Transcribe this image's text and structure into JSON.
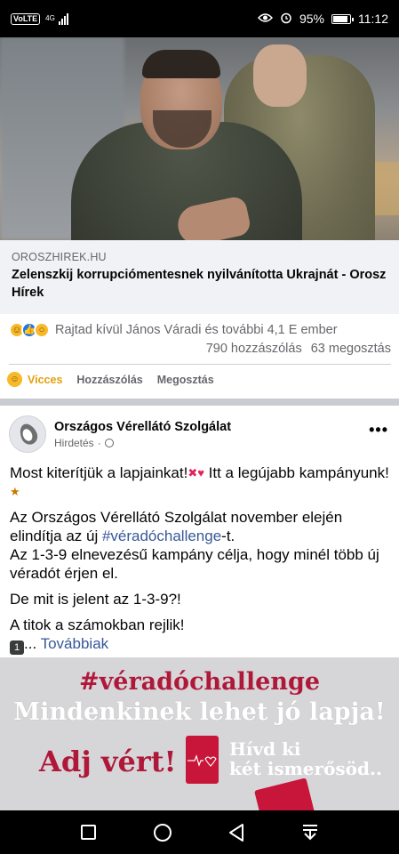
{
  "status_bar": {
    "network_badge": "VoLTE",
    "network_type": "4G",
    "battery_percent": "95%",
    "time": "11:12",
    "icons": [
      "eye-icon",
      "alarm-icon",
      "battery-icon",
      "signal-icon"
    ]
  },
  "link_preview": {
    "domain": "OROSZHIREK.HU",
    "headline": "Zelenszkij korrupciómentesnek nyilvánította Ukrajnát - Orosz Hírek"
  },
  "reactions": {
    "types": [
      "haha",
      "like",
      "wow"
    ],
    "summary": "Rajtad kívül János Váradi és további 4,1 E ember",
    "comments": "790 hozzászólás",
    "shares": "63 megosztás"
  },
  "post_actions": {
    "reacted_label": "Vicces",
    "comment_label": "Hozzászólás",
    "share_label": "Megosztás"
  },
  "ad_post": {
    "page_name": "Országos Vérellátó Szolgálat",
    "sponsored_label": "Hirdetés",
    "more_label": "•••",
    "p1_a": "Most kiterítjük a lapjainkat!",
    "p1_b": " Itt a legújabb kampányunk!",
    "p2_a": "Az Országos Vérellátó Szolgálat november elején elindítja az új ",
    "p2_tag": "#véradóchallenge",
    "p2_b": "-t.",
    "p3": "Az 1-3-9 elnevezésű kampány célja, hogy minél több új véradót érjen el.",
    "p4": "De mit is jelent az 1-3-9?!",
    "p5": "A titok a számokban rejlik!",
    "keycap": "1",
    "ellipsis": "... ",
    "see_more": "Továbbiak"
  },
  "banner": {
    "hashtag": "#véradóchallenge",
    "line2": "Mindenkinek lehet jó lapja!",
    "adj": "Adj vért!",
    "hivd_1": "Hívd ki",
    "hivd_2": "két ismerősöd.."
  },
  "colors": {
    "link_blue": "#385898",
    "haha_yellow": "#f7b928",
    "banner_red": "#b0183a",
    "secondary_text": "#65676b"
  }
}
